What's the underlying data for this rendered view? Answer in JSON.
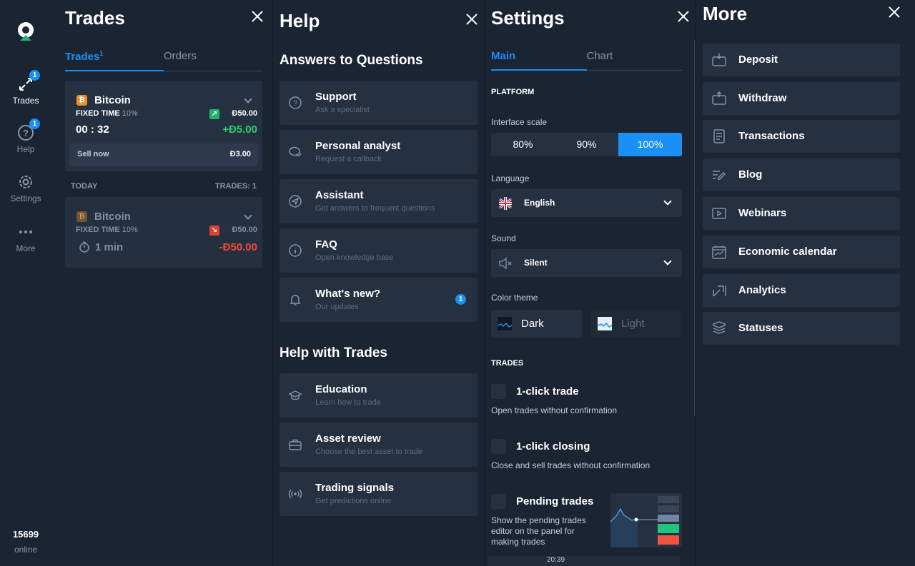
{
  "rail": {
    "items": [
      {
        "label": "Trades",
        "badge": "1"
      },
      {
        "label": "Help",
        "badge": "1"
      },
      {
        "label": "Settings"
      },
      {
        "label": "More"
      }
    ],
    "online_count": "15699",
    "online_label": "online"
  },
  "trades": {
    "title": "Trades",
    "tabs": [
      {
        "label": "Trades",
        "sup": "1"
      },
      {
        "label": "Orders"
      }
    ],
    "active_trade": {
      "asset": "Bitcoin",
      "type": "FIXED TIME",
      "pct": "10%",
      "amount": "Ð50.00",
      "timer": "00 : 32",
      "profit": "+Ð5.00",
      "sell_label": "Sell now",
      "sell_value": "Ð3.00"
    },
    "section_label": "TODAY",
    "section_count": "TRADES: 1",
    "closed_trade": {
      "asset": "Bitcoin",
      "type": "FIXED TIME",
      "pct": "10%",
      "amount": "Ð50.00",
      "duration": "1 min",
      "result": "-Ð50.00"
    },
    "colors": {
      "profit": "#2ecc71",
      "loss": "#ff4b3a"
    }
  },
  "help": {
    "title": "Help",
    "section1": "Answers to Questions",
    "items1": [
      {
        "title": "Support",
        "sub": "Ask a specialist",
        "icon": "question-circle-icon"
      },
      {
        "title": "Personal analyst",
        "sub": "Request a callback",
        "icon": "chat-icon"
      },
      {
        "title": "Assistant",
        "sub": "Get answers to frequent questions",
        "icon": "navigation-icon"
      },
      {
        "title": "FAQ",
        "sub": "Open knowledge base",
        "icon": "info-icon"
      },
      {
        "title": "What's new?",
        "sub": "Our updates",
        "icon": "bell-icon",
        "badge": "1"
      }
    ],
    "section2": "Help with Trades",
    "items2": [
      {
        "title": "Education",
        "sub": "Learn how to trade",
        "icon": "graduation-cap-icon"
      },
      {
        "title": "Asset review",
        "sub": "Choose the best asset to trade",
        "icon": "briefcase-icon"
      },
      {
        "title": "Trading signals",
        "sub": "Get predictions online",
        "icon": "signal-icon"
      }
    ]
  },
  "settings": {
    "title": "Settings",
    "tabs": [
      {
        "label": "Main"
      },
      {
        "label": "Chart"
      }
    ],
    "platform_head": "PLATFORM",
    "scale_label": "Interface scale",
    "scale_options": [
      "80%",
      "90%",
      "100%"
    ],
    "scale_selected": "100%",
    "language_label": "Language",
    "language_value": "English",
    "sound_label": "Sound",
    "sound_value": "Silent",
    "theme_label": "Color theme",
    "theme_dark": "Dark",
    "theme_light": "Light",
    "trades_head": "TRADES",
    "one_click_trade": "1-click trade",
    "one_click_trade_desc": "Open trades without confirmation",
    "one_click_closing": "1-click closing",
    "one_click_closing_desc": "Close and sell trades without confirmation",
    "pending_trades": "Pending trades",
    "pending_trades_desc": "Show the pending trades editor on the panel for making trades",
    "time_label": "20:39",
    "accent": "#1a8ff4"
  },
  "more": {
    "title": "More",
    "items": [
      {
        "label": "Deposit",
        "icon": "wallet-in-icon"
      },
      {
        "label": "Withdraw",
        "icon": "wallet-out-icon"
      },
      {
        "label": "Transactions",
        "icon": "document-icon"
      },
      {
        "label": "Blog",
        "icon": "edit-lines-icon"
      },
      {
        "label": "Webinars",
        "icon": "play-screen-icon"
      },
      {
        "label": "Economic calendar",
        "icon": "calendar-chart-icon"
      },
      {
        "label": "Analytics",
        "icon": "analytics-icon"
      },
      {
        "label": "Statuses",
        "icon": "layers-icon"
      }
    ]
  }
}
